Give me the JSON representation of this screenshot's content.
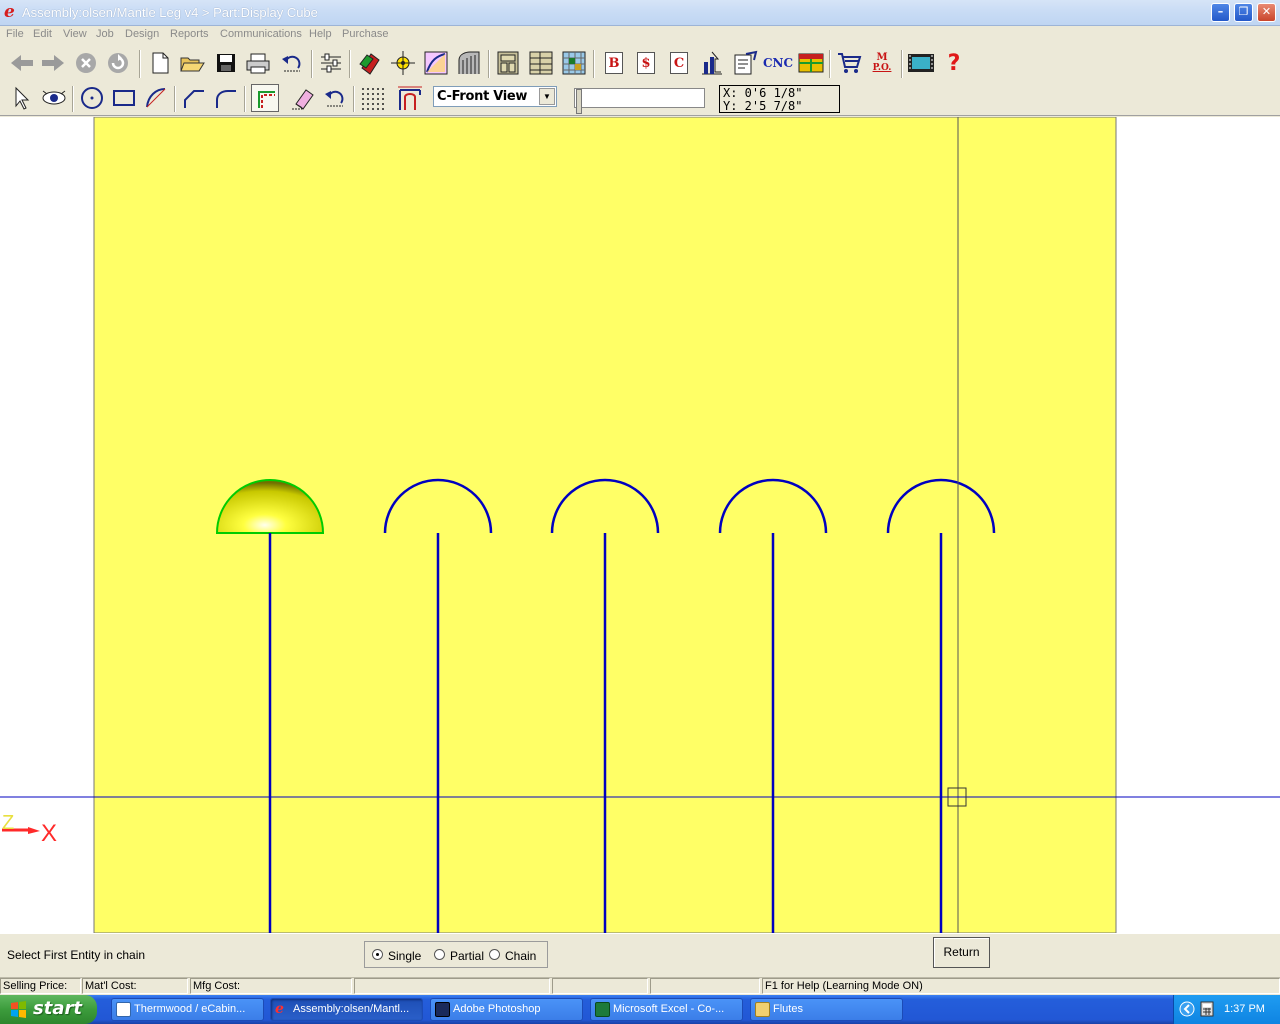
{
  "window": {
    "title": "Assembly:olsen/Mantle Leg v4 > Part:Display Cube",
    "logo": "e",
    "minimize_glyph": "–",
    "maximize_glyph": "❐",
    "close_glyph": "✕"
  },
  "menu": [
    "File",
    "Edit",
    "View",
    "Job",
    "Design",
    "Reports",
    "Communications",
    "Help",
    "Purchase"
  ],
  "toolbar1": {
    "nav_icons": [
      "back-arrow-icon",
      "forward-arrow-icon",
      "stop-icon",
      "refresh-icon"
    ],
    "file_icons": [
      "new-file-icon",
      "open-folder-icon",
      "save-icon",
      "print-icon",
      "undo-icon"
    ],
    "letter_buttons": [
      "B",
      "$",
      "C"
    ],
    "cnc_label": "CNC",
    "mpo_label_top": "M",
    "mpo_label_bottom": "P.O.",
    "help_label": "?"
  },
  "toolbar2": {
    "view_select": {
      "value": "C-Front View"
    },
    "coords": {
      "x": "X: 0'6 1/8\"",
      "y": "Y: 2'5 7/8\""
    }
  },
  "canvas": {
    "background": "#ffffff",
    "sheet_color": "#ffff66",
    "curve_color": "#0000c0",
    "axis_color": "#0000c0",
    "highlight_color": "#00cc00",
    "axis_labels": {
      "z": "Z",
      "x": "X"
    }
  },
  "command": {
    "prompt": "Select First Entity in chain",
    "modes": [
      {
        "label": "Single",
        "selected": true
      },
      {
        "label": "Partial",
        "selected": false
      },
      {
        "label": "Chain",
        "selected": false
      }
    ],
    "return_label": "Return"
  },
  "status": {
    "selling_price": "Selling Price:",
    "matl_cost": "Mat'l Cost:",
    "mfg_cost": "Mfg Cost:",
    "help": "F1 for Help (Learning Mode ON)"
  },
  "taskbar": {
    "start": "start",
    "tasks": [
      {
        "label": "Thermwood / eCabin...",
        "active": false
      },
      {
        "label": "Assembly:olsen/Mantl...",
        "active": true
      },
      {
        "label": "Adobe Photoshop",
        "active": false
      },
      {
        "label": "Microsoft Excel - Co-...",
        "active": false
      },
      {
        "label": "Flutes",
        "active": false
      }
    ],
    "clock": "1:37 PM"
  }
}
